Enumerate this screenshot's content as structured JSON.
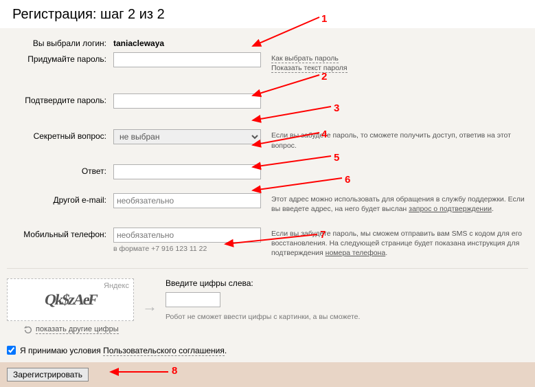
{
  "page_title": "Регистрация: шаг 2 из 2",
  "login_row": {
    "label": "Вы выбрали логин:",
    "value": "taniaclewaya"
  },
  "password": {
    "label": "Придумайте пароль:",
    "hint_choose": "Как выбрать пароль",
    "hint_show": "Показать текст пароля"
  },
  "password_confirm": {
    "label": "Подтвердите пароль:"
  },
  "secret_question": {
    "label": "Секретный вопрос:",
    "selected": "не выбран",
    "hint": "Если вы забудете пароль, то сможете получить доступ, ответив на этот вопрос."
  },
  "answer": {
    "label": "Ответ:"
  },
  "other_email": {
    "label": "Другой e-mail:",
    "placeholder": "необязательно",
    "hint_pre": "Этот адрес можно использовать для обращения в службу поддержки. Если вы введете адрес, на него будет выслан ",
    "hint_link": "запрос о подтверждении",
    "hint_post": "."
  },
  "phone": {
    "label": "Мобильный телефон:",
    "placeholder": "необязательно",
    "format_hint": "в формате +7 916 123 11 22",
    "hint_pre": "Если вы забудете пароль, мы сможем отправить вам SMS с кодом для его восстановления. На следующей странице будет показана инструкция для подтверждения ",
    "hint_link": "номера телефона",
    "hint_post": "."
  },
  "captcha": {
    "brand": "Яндекс",
    "scribble": "Qk$zAeF",
    "refresh": "показать другие цифры",
    "label": "Введите цифры слева:",
    "note": "Робот не сможет ввести цифры с картинки, а вы сможете."
  },
  "agreement": {
    "pre": "Я принимаю условия ",
    "link": "Пользовательского соглашения",
    "post": "."
  },
  "submit": {
    "label": "Зарегистрировать"
  },
  "annotations": {
    "1": "1",
    "2": "2",
    "3": "3",
    "4": "4",
    "5": "5",
    "6": "6",
    "7": "7",
    "8": "8"
  }
}
